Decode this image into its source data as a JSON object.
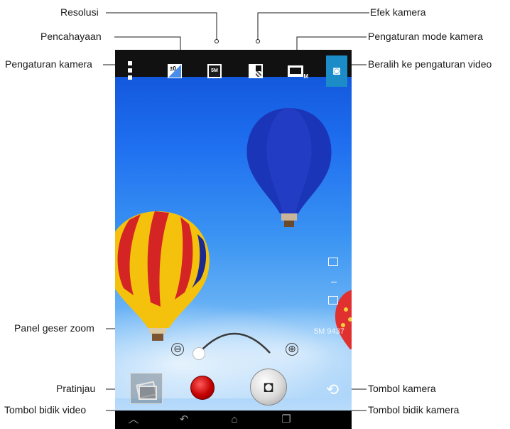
{
  "callouts": {
    "resolusi": "Resolusi",
    "pencahayaan": "Pencahayaan",
    "pengaturan_kamera": "Pengaturan kamera",
    "efek_kamera": "Efek kamera",
    "pengaturan_mode": "Pengaturan mode kamera",
    "beralih_video": "Beralih ke pengaturan video",
    "panel_zoom": "Panel geser zoom",
    "pratinjau": "Pratinjau",
    "tombol_bidik_video": "Tombol bidik video",
    "tombol_kamera": "Tombol kamera",
    "tombol_bidik_kamera": "Tombol bidik kamera"
  },
  "screen": {
    "exposure_icon_text": "±0",
    "resolution_icon_text": "5M",
    "mode_icon_text": "M",
    "side_counter": "5M 9437",
    "zoom_minus": "⊖",
    "zoom_plus": "⊕"
  },
  "icons": {
    "settings": "vertical-dots-icon",
    "exposure": "exposure-icon",
    "resolution": "resolution-icon",
    "effect": "effect-icon",
    "mode": "camera-mode-icon",
    "video_switch": "video-camera-icon",
    "shutter": "camera-icon",
    "record": "record-dot-icon",
    "preview": "gallery-icon",
    "cam_toggle": "switch-camera-icon",
    "nav_up": "chevron-up-icon",
    "nav_back": "back-arrow-icon",
    "nav_home": "home-icon",
    "nav_recent": "recent-apps-icon"
  },
  "colors": {
    "sky_top": "#0e4fd6",
    "sky_bottom": "#c9e3fb",
    "video_switch_bg": "#1b8cc8",
    "record_red": "#c40000"
  }
}
